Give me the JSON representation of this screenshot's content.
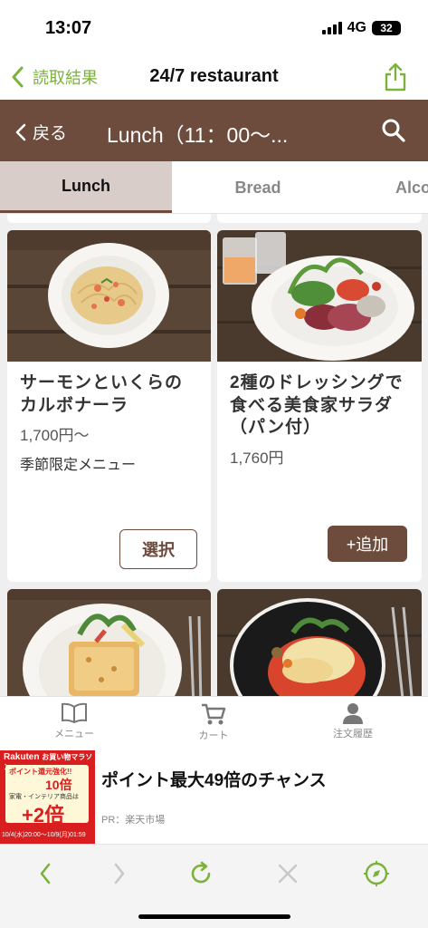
{
  "status_bar": {
    "time": "13:07",
    "network": "4G",
    "battery": "32"
  },
  "header": {
    "back_label": "読取結果",
    "title": "24/7 restaurant"
  },
  "nav": {
    "back_label": "戻る",
    "title": "Lunch（11：00〜..."
  },
  "tabs": [
    {
      "label": "Lunch",
      "active": true
    },
    {
      "label": "Bread",
      "active": false
    },
    {
      "label": "Alco",
      "active": false
    }
  ],
  "menu_items": [
    {
      "name_line1": "サーモンといくらの",
      "name_line2": "カルボナーラ",
      "price": "1,700円〜",
      "note": "季節限定メニュー",
      "button": "選択"
    },
    {
      "name_line1": "2種のドレッシングで",
      "name_line2": "食べる美食家サラダ",
      "name_line3": "（パン付）",
      "price": "1,760円",
      "button": "+追加"
    }
  ],
  "bottom_tabs": [
    {
      "label": "メニュー",
      "icon": "book-icon"
    },
    {
      "label": "カート",
      "icon": "cart-icon"
    },
    {
      "label": "注文履歴",
      "icon": "person-icon"
    }
  ],
  "ad": {
    "title": "ポイント最大49倍のチャンス",
    "pr": "PR：楽天市場",
    "banner": {
      "brand": "Rakuten",
      "campaign": "お買い物マラソン",
      "tagline": "ポイント還元強化!!",
      "multiplier": "10倍",
      "category": "家電・インテリア商品は",
      "plus": "+2倍",
      "period": "10/4(水)20:00〜10/9(月)01:59"
    }
  },
  "colors": {
    "brand_brown": "#6d4c3d",
    "accent_green": "#7bb33a",
    "tab_active_bg": "#d9cdca"
  }
}
